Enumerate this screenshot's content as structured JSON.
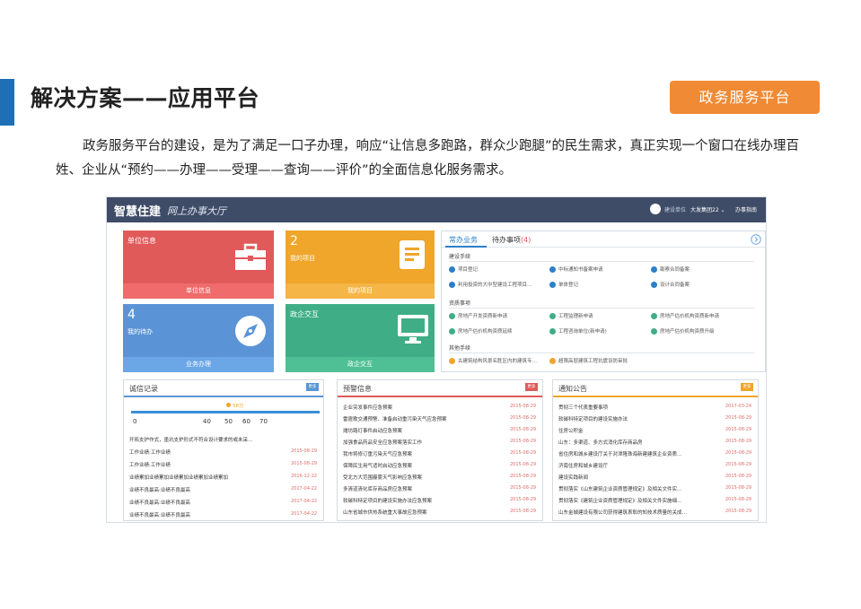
{
  "slide": {
    "title": "解决方案——应用平台",
    "tag": "政务服务平台",
    "paragraph": "政务服务平台的建设，是为了满足一口子办理，响应“让信息多跑路，群众少跑腿”的民生需求，真正实现一个窗口在线办理百姓、企业从“预约——办理——受理——查询——评价”的全面信息化服务需求。"
  },
  "colors": {
    "accent": "#1f6fb5",
    "tag": "#f08a34",
    "header": "#3f4c67",
    "red": "#e05a5a",
    "orange": "#f0a52b",
    "blue": "#5a94d6",
    "green": "#3fae86",
    "link": "#2c7fc9"
  },
  "app": {
    "brand": "智慧住建",
    "subtitle": "网上办事大厅",
    "user": "建设单位",
    "org": "大发集团22 ⌄",
    "guide": "办事指南"
  },
  "tiles": [
    {
      "title": "单位信息",
      "bar": "单位信息",
      "icon": "briefcase-icon"
    },
    {
      "number": "2",
      "title": "我的项目",
      "bar": "我的项目",
      "icon": "document-icon"
    },
    {
      "number": "4",
      "title": "我的待办",
      "bar": "业务办理",
      "icon": "compass-icon"
    },
    {
      "title": "政企交互",
      "bar": "政企交互",
      "icon": "monitor-icon"
    }
  ],
  "services": {
    "tab_active": "常办业务",
    "tab_pending": "待办事项",
    "pending_count": "(4)",
    "sections": [
      {
        "title": "建设手续",
        "items": [
          "项目登记",
          "中标通知书备案申请",
          "勘察合同备案",
          "利用投资的大中型建设工程项目…",
          "单体登记",
          "设计合同备案"
        ]
      },
      {
        "title": "资质事项",
        "items": [
          "房地产开发资质新申请",
          "工程监理新申请",
          "房地产估价机构资质新申请",
          "房地产估价机构资质延续",
          "工程咨询单位(新申请)",
          "房地产估价机构资质升级"
        ]
      },
      {
        "title": "其他手续",
        "items": [
          "古建筑结构风景名胜区内的建筑专…",
          "超限高层建筑工程抗震设防审批"
        ]
      }
    ]
  },
  "credit": {
    "title": "诚信记录",
    "more": "更多",
    "score": "58分",
    "ticks": [
      "0",
      "40",
      "50",
      "60",
      "70"
    ],
    "desc": "开拓支护作式，墨坑支护形式不符合设计要求的或未采…",
    "rows": [
      {
        "text": "工作业绩:工作业绩",
        "date": "2015-08-29"
      },
      {
        "text": "工作业绩:工作业绩",
        "date": "2015-08-29"
      },
      {
        "text": "业绩累加业绩累加业绩累加业绩累加业绩累加",
        "date": "2016-12-22"
      },
      {
        "text": "业绩不良最高:业绩不良最高",
        "date": "2017-04-22"
      },
      {
        "text": "业绩不良最高:业绩不良最高",
        "date": "2017-04-22"
      },
      {
        "text": "业绩不良最高:业绩不良最高",
        "date": "2017-04-22"
      }
    ]
  },
  "warning": {
    "title": "预警信息",
    "more": "更多",
    "rows": [
      {
        "text": "企业突发事件应急预案",
        "date": "2015-08-29"
      },
      {
        "text": "雷霆歌交通预警、准备启动重污染天气应急预案",
        "date": "2015-08-29"
      },
      {
        "text": "潍坊路灯事件启动应急预案",
        "date": "2015-08-29"
      },
      {
        "text": "加强食品药品安全应急预案落实工作",
        "date": "2015-08-29"
      },
      {
        "text": "我市将修订重污染天气应急预案",
        "date": "2015-08-29"
      },
      {
        "text": "保障民生用气适时启动应急预案",
        "date": "2015-08-29"
      },
      {
        "text": "受北方大范围霾雾天气影响应急预案",
        "date": "2015-08-29"
      },
      {
        "text": "多清道清化库存商品房应急预案",
        "date": "2015-08-29"
      },
      {
        "text": "软碳科特定项目的建设实施办法应急预案",
        "date": "2015-08-29"
      },
      {
        "text": "山东省城市供热系统重大事故应急预案",
        "date": "2015-08-29"
      }
    ]
  },
  "notice": {
    "title": "通知公告",
    "more": "更多",
    "rows": [
      {
        "text": "贯彻三个代表重要事项",
        "date": "2017-03-24"
      },
      {
        "text": "软碳科特定项目的建设实施办法",
        "date": "2015-08-29"
      },
      {
        "text": "住房公积金",
        "date": "2015-08-29"
      },
      {
        "text": "山东：多渠道、多方式消化库存商品房",
        "date": "2015-08-29"
      },
      {
        "text": "省住房和城乡建设厅关于对泄隆珠海新建建筑企业资质…",
        "date": "2015-08-29"
      },
      {
        "text": "济南住房和城乡建设厅",
        "date": "2015-08-29"
      },
      {
        "text": "建设实践新闻",
        "date": "2015-08-29"
      },
      {
        "text": "贯彻落实《山东建筑企业资质管理规定》及相关文件实…",
        "date": "2015-08-29"
      },
      {
        "text": "贯彻落实《建筑企业资质管理规定》及相关文件实施细…",
        "date": "2015-08-29"
      },
      {
        "text": "山东金城建设有限公司获得建筑表彰的知技术质量的关成…",
        "date": "2015-08-29"
      }
    ]
  }
}
